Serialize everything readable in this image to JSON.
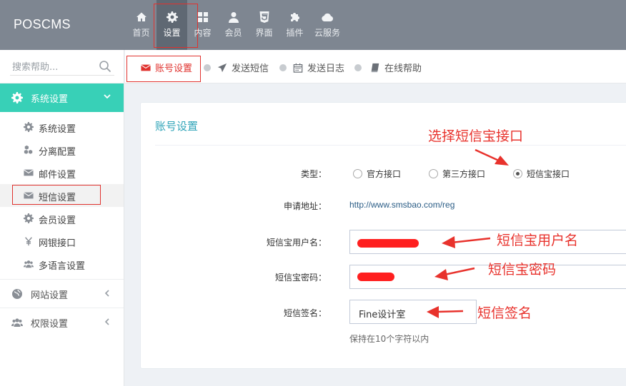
{
  "header": {
    "brand": "POSCMS",
    "nav": [
      {
        "label": "首页",
        "icon": "home-icon"
      },
      {
        "label": "设置",
        "icon": "gear-icon",
        "active": true
      },
      {
        "label": "内容",
        "icon": "grid-icon"
      },
      {
        "label": "会员",
        "icon": "user-icon"
      },
      {
        "label": "界面",
        "icon": "html5-icon"
      },
      {
        "label": "插件",
        "icon": "puzzle-icon"
      },
      {
        "label": "云服务",
        "icon": "cloud-icon"
      }
    ]
  },
  "sidebar": {
    "search_placeholder": "搜索帮助...",
    "groups": [
      {
        "label": "系统设置",
        "icon": "gear-icon",
        "expanded": true,
        "items": [
          {
            "label": "系统设置",
            "icon": "gear-icon"
          },
          {
            "label": "分离配置",
            "icon": "cubes-icon"
          },
          {
            "label": "邮件设置",
            "icon": "envelope-icon"
          },
          {
            "label": "短信设置",
            "icon": "envelope-icon",
            "active": true
          },
          {
            "label": "会员设置",
            "icon": "gear-icon"
          },
          {
            "label": "网银接口",
            "icon": "yen-icon"
          },
          {
            "label": "多语言设置",
            "icon": "users-icon"
          }
        ]
      },
      {
        "label": "网站设置",
        "icon": "globe-icon",
        "expanded": false
      },
      {
        "label": "权限设置",
        "icon": "users-icon",
        "expanded": false
      }
    ]
  },
  "tabs": [
    {
      "label": "账号设置",
      "icon": "envelope-icon",
      "active": true
    },
    {
      "label": "发送短信",
      "icon": "send-icon"
    },
    {
      "label": "发送日志",
      "icon": "calendar-icon"
    },
    {
      "label": "在线帮助",
      "icon": "book-icon"
    }
  ],
  "panel": {
    "title": "账号设置",
    "type_label": "类型：",
    "type_options": [
      {
        "label": "官方接口",
        "checked": false
      },
      {
        "label": "第三方接口",
        "checked": false
      },
      {
        "label": "短信宝接口",
        "checked": true
      }
    ],
    "apply_label": "申请地址：",
    "apply_url": "http://www.smsbao.com/reg",
    "username_label": "短信宝用户名：",
    "password_label": "短信宝密码：",
    "signature_label": "短信签名：",
    "signature_value": "Fine设计室",
    "signature_hint": "保持在10个字符以内"
  },
  "annotations": {
    "choose": "选择短信宝接口",
    "username": "短信宝用户名",
    "password": "短信宝密码",
    "signature": "短信签名"
  },
  "colors": {
    "topbar": "#7e8691",
    "accent_teal": "#38d0b7",
    "highlight_red": "#e0322e",
    "panel_title": "#2fa4b8"
  }
}
